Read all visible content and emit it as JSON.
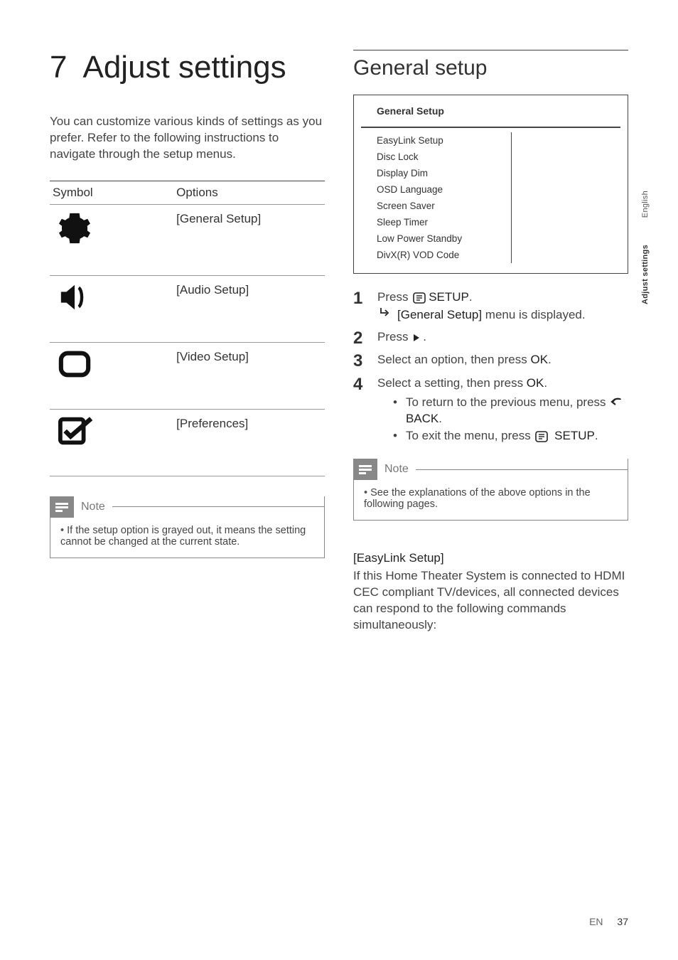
{
  "chapter": {
    "number": "7",
    "title": "Adjust settings"
  },
  "intro": "You can customize various kinds of settings as you prefer. Refer to the following instructions to navigate through the setup menus.",
  "optionsTable": {
    "h1": "Symbol",
    "h2": "Options",
    "rows": [
      {
        "opt": "[General Setup]"
      },
      {
        "opt": "[Audio Setup]"
      },
      {
        "opt": "[Video Setup]"
      },
      {
        "opt": "[Preferences]"
      }
    ]
  },
  "noteLeft": {
    "label": "Note",
    "text": "If the setup option is grayed out, it means the setting cannot be changed at the current state."
  },
  "sectionTitle": "General setup",
  "menu": {
    "header": "General Setup",
    "items": [
      "EasyLink Setup",
      "Disc Lock",
      "Display Dim",
      "OSD Language",
      "Screen Saver",
      "Sleep Timer",
      "Low Power Standby",
      "DivX(R) VOD Code"
    ]
  },
  "steps": {
    "s1": {
      "a": "Press ",
      "b": "SETUP",
      "c": ".",
      "sub_a": "[General Setup]",
      "sub_b": " menu is displayed."
    },
    "s2": {
      "a": "Press ",
      "c": "."
    },
    "s3": {
      "a": "Select an option, then press ",
      "b": "OK",
      "c": "."
    },
    "s4": {
      "a": "Select a setting, then press ",
      "b": "OK",
      "c": ".",
      "b1_a": "To return to the previous menu, press ",
      "b1_b": "BACK",
      "b1_c": ".",
      "b2_a": "To exit the menu, press ",
      "b2_b": "SETUP",
      "b2_c": "."
    }
  },
  "noteRight": {
    "label": "Note",
    "text": "See the explanations of the above options in the following pages."
  },
  "feature": {
    "title": "[EasyLink Setup]",
    "body": "If this Home Theater System is connected to HDMI CEC compliant TV/devices, all connected devices can respond to the following commands simultaneously:"
  },
  "sideTabs": {
    "t1": "English",
    "t2": "Adjust settings"
  },
  "footer": {
    "lang": "EN",
    "page": "37"
  }
}
